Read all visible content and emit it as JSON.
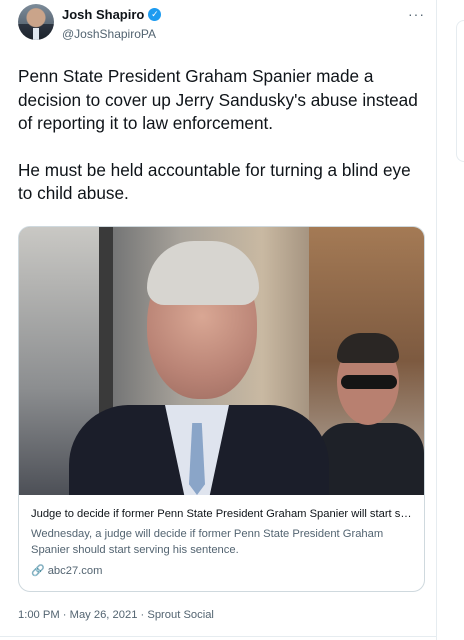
{
  "author": {
    "name": "Josh Shapiro",
    "handle": "@JoshShapiroPA",
    "verified_glyph": "✓"
  },
  "more_menu": "···",
  "tweet": {
    "paragraphs": [
      "Penn State President Graham Spanier made a decision to cover up Jerry Sandusky's abuse instead of reporting it to law enforcement.",
      "He must be held accountable for turning a blind eye to child abuse."
    ]
  },
  "card": {
    "title": "Judge to decide if former Penn State President Graham Spanier will start servin...",
    "description": "Wednesday, a judge will decide if former Penn State President Graham Spanier should start serving his sentence.",
    "domain": "abc27.com",
    "link_icon": "link-icon"
  },
  "meta": {
    "time": "1:00 PM",
    "separator": " · ",
    "date": "May 26, 2021",
    "source": "Sprout Social"
  },
  "colors": {
    "accent": "#1d9bf0",
    "text": "#0f1419",
    "secondary": "#536471",
    "border": "#cfd9de"
  }
}
